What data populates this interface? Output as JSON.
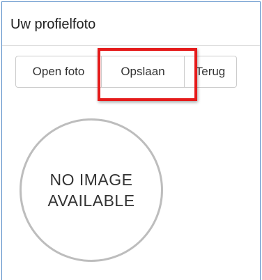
{
  "panel": {
    "title": "Uw profielfoto"
  },
  "toolbar": {
    "open_label": "Open foto",
    "save_label": "Opslaan",
    "back_label": "Terug",
    "highlighted_button": "save",
    "highlight_color": "#e51b1b"
  },
  "profile_image": {
    "placeholder_line1": "NO IMAGE",
    "placeholder_line2": "AVAILABLE"
  },
  "colors": {
    "panel_border": "#5b8fc9",
    "button_border": "#cccccc"
  }
}
